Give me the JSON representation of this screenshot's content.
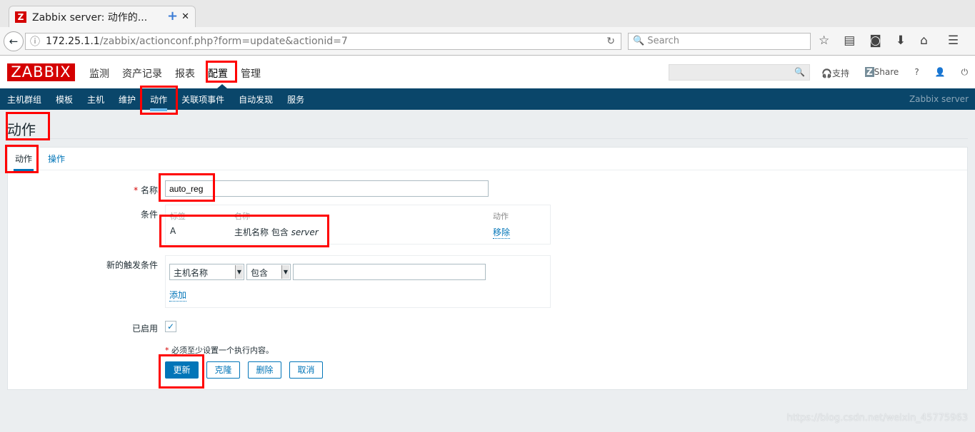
{
  "browser": {
    "tab_title": "Zabbix server: 动作的...",
    "favicon": "Z",
    "url_host": "172.25.1.1",
    "url_path": "/zabbix/actionconf.php?form=update&actionid=7",
    "search_placeholder": "Search"
  },
  "header": {
    "logo": "ZABBIX",
    "menu": [
      "监测",
      "资产记录",
      "报表",
      "配置",
      "管理"
    ],
    "selected_menu": "配置",
    "support": "支持",
    "share": "Share",
    "help": "?"
  },
  "submenu": {
    "items": [
      "主机群组",
      "模板",
      "主机",
      "维护",
      "动作",
      "关联项事件",
      "自动发现",
      "服务"
    ],
    "selected": "动作",
    "server_name": "Zabbix server"
  },
  "page": {
    "title": "动作",
    "tabs": [
      "动作",
      "操作"
    ]
  },
  "form": {
    "name_label": "名称",
    "name_value": "auto_reg",
    "conditions_label": "条件",
    "conditions_headers": [
      "标签",
      "名称",
      "动作"
    ],
    "conditions": [
      {
        "label": "A",
        "name": "主机名称 包含",
        "value": "server",
        "action": "移除"
      }
    ],
    "new_condition_label": "新的触发条件",
    "condition_type": "主机名称",
    "condition_operator": "包含",
    "condition_value": "",
    "add_link": "添加",
    "enabled_label": "已启用",
    "enabled": true,
    "notice": "必须至少设置一个执行内容。",
    "buttons": {
      "update": "更新",
      "clone": "克隆",
      "delete": "删除",
      "cancel": "取消"
    }
  },
  "watermark": "https://blog.csdn.net/weixin_45775963",
  "colors": {
    "brand": "#d40000",
    "nav": "#0a466a",
    "accent": "#0275b8",
    "highlight": "#ff0000"
  }
}
